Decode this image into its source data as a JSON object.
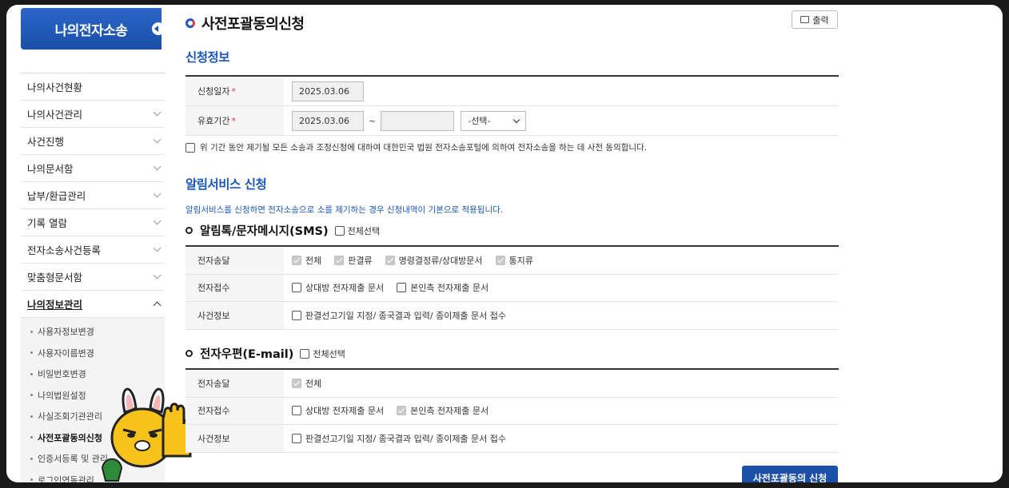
{
  "sidebar": {
    "title": "나의전자소송",
    "menu": [
      {
        "label": "나의사건현황",
        "chevron": false
      },
      {
        "label": "나의사건관리",
        "chevron": true
      },
      {
        "label": "사건진행",
        "chevron": true
      },
      {
        "label": "나의문서함",
        "chevron": true
      },
      {
        "label": "납부/환급관리",
        "chevron": true
      },
      {
        "label": "기록 열람",
        "chevron": true
      },
      {
        "label": "전자소송사건등록",
        "chevron": true
      },
      {
        "label": "맞춤형문서함",
        "chevron": true
      },
      {
        "label": "나의정보관리",
        "chevron": true,
        "open": true
      }
    ],
    "submenu": [
      "사용자정보변경",
      "사용자이름변경",
      "비밀번호변경",
      "나의법원설정",
      "사실조회기관관리",
      "사전포괄동의신청",
      "인증서등록 및 관리",
      "로그인연동관리"
    ],
    "active_submenu": "사전포괄동의신청"
  },
  "header": {
    "title": "사전포괄동의신청",
    "print_label": "출력"
  },
  "application": {
    "section_title": "신청정보",
    "apply_date_label": "신청일자",
    "apply_date_value": "2025.03.06",
    "valid_period_label": "유효기간",
    "valid_from": "2025.03.06",
    "valid_sep": "~",
    "valid_to": "",
    "period_select": "-선택-",
    "required_mark": "*",
    "agree_text": "위 기간 동안 제기될 모든 소송과 조정신청에 대하여 대한민국 법원 전자소송포털에 의하여 전자소송을 하는 데 사전 동의합니다."
  },
  "notify": {
    "section_title": "알림서비스 신청",
    "notice": "알림서비스를 신청하면 전자소송으로 소를 제기하는 경우 신청내역이 기본으로 적용됩니다.",
    "select_all_label": "전체선택",
    "sms": {
      "title": "알림톡/문자메시지(SMS)",
      "rows": [
        {
          "label": "전자송달",
          "options": [
            {
              "text": "전체",
              "checked": true
            },
            {
              "text": "판결류",
              "checked": true
            },
            {
              "text": "명령결정류/상대방문서",
              "checked": true
            },
            {
              "text": "통지류",
              "checked": true
            }
          ]
        },
        {
          "label": "전자접수",
          "options": [
            {
              "text": "상대방 전자제출 문서",
              "checked": false
            },
            {
              "text": "본인측 전자제출 문서",
              "checked": false
            }
          ]
        },
        {
          "label": "사건정보",
          "options": [
            {
              "text": "판결선고기일 지정/ 종국결과 입력/ 종이제출 문서 접수",
              "checked": false
            }
          ]
        }
      ]
    },
    "email": {
      "title": "전자우편(E-mail)",
      "rows": [
        {
          "label": "전자송달",
          "options": [
            {
              "text": "전체",
              "checked": true
            }
          ]
        },
        {
          "label": "전자접수",
          "options": [
            {
              "text": "상대방 전자제출 문서",
              "checked": false
            },
            {
              "text": "본인측 전자제출 문서",
              "checked": true
            }
          ]
        },
        {
          "label": "사건정보",
          "options": [
            {
              "text": "판결선고기일 지정/ 종국결과 입력/ 종이제출 문서 접수",
              "checked": false
            }
          ]
        }
      ]
    }
  },
  "submit_label": "사전포괄동의 신청",
  "colors": {
    "primary": "#1a56b8",
    "button": "#1c4fa8",
    "required": "#e23d3d"
  }
}
